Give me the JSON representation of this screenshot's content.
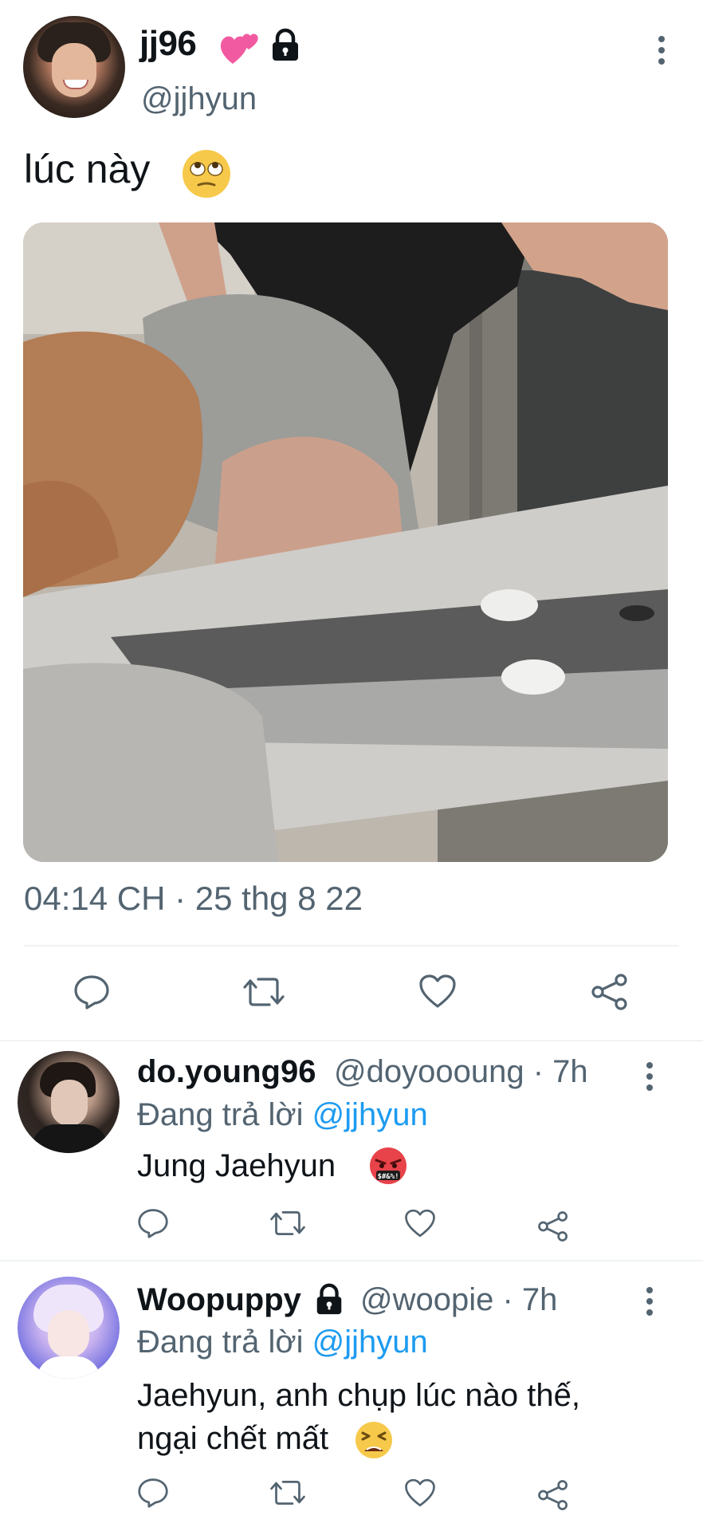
{
  "tweet": {
    "author_name": "jj96",
    "author_handle": "@jjhyun",
    "text": "lúc này",
    "timestamp": "04:14 CH · 25 thg 8 22",
    "icons": [
      "two-hearts-emoji",
      "lock-icon",
      "more-icon",
      "rolling-eyes-emoji"
    ]
  },
  "actions": [
    "reply-icon",
    "retweet-icon",
    "like-icon",
    "share-icon"
  ],
  "replies": [
    {
      "name": "do.young96",
      "handle": "@doyoooung · 7h",
      "replying_prefix": "Đang trả lời",
      "replying_to": "@jjhyun",
      "text": "Jung Jaehyun",
      "emoji": "cursing-face-emoji"
    },
    {
      "name": "Woopuppy",
      "handle": "@woopie · 7h",
      "replying_prefix": "Đang trả lời",
      "replying_to": "@jjhyun",
      "text_line1": "Jaehyun, anh chụp lúc nào thế,",
      "text_line2": "ngại chết mất",
      "emoji": "tired-face-emoji",
      "locked": true
    }
  ],
  "colors": {
    "text_primary": "#0f1419",
    "text_secondary": "#536471",
    "mention": "#1d9bf0",
    "divider": "#eff3f4"
  }
}
